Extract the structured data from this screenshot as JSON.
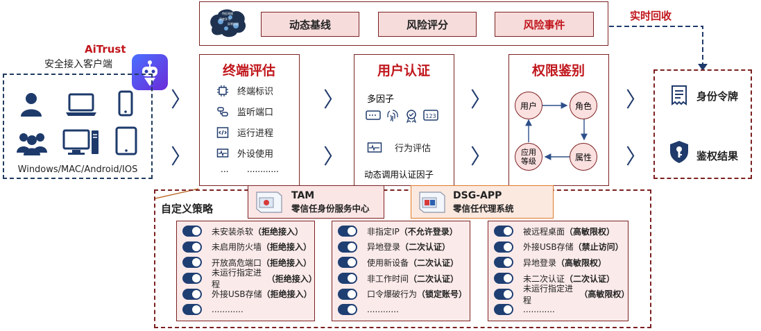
{
  "top": {
    "buttons": [
      "动态基线",
      "风险评分",
      "风险事件"
    ],
    "feedback_label": "实时回收"
  },
  "client": {
    "brand": "AiTrust",
    "subtitle": "安全接入客户端",
    "platforms": "Windows/MAC/Android/IOS"
  },
  "endpoint": {
    "title": "终端评估",
    "items": [
      "终端标识",
      "监听端口",
      "运行进程",
      "外设使用"
    ],
    "more_left": "...",
    "more_right": "............"
  },
  "auth": {
    "title": "用户认证",
    "multi_factor": "多因子",
    "behavior": "行为评估",
    "dynamic": "动态调用认证因子"
  },
  "perm": {
    "title": "权限鉴别",
    "nodes": {
      "user": "用户",
      "role": "角色",
      "app_level": "应用\n等级",
      "attr": "属性"
    }
  },
  "result": {
    "token": "身份令牌",
    "auth_result": "鉴权结果"
  },
  "systems": {
    "tam_name": "TAM",
    "tam_desc": "零信任身份服务中心",
    "dsg_name": "DSG-APP",
    "dsg_desc": "零信任代理系统"
  },
  "policy": {
    "title": "自定义策略",
    "col1": [
      [
        "未安装杀软",
        "（拒绝接入）"
      ],
      [
        "未启用防火墙",
        "（拒绝接入）"
      ],
      [
        "开放高危端口",
        "（拒绝接入）"
      ],
      [
        "未运行指定进程",
        "（拒绝接入）"
      ],
      [
        "外接USB存储",
        "（拒绝接入）"
      ],
      [
        "............",
        ""
      ]
    ],
    "col2": [
      [
        "非指定IP",
        "（不允许登录）"
      ],
      [
        "异地登录",
        "（二次认证）"
      ],
      [
        "使用新设备",
        "（二次认证）"
      ],
      [
        "非工作时间",
        "（二次认证）"
      ],
      [
        "口令爆破行为",
        "（锁定账号）"
      ],
      [
        "............",
        ""
      ]
    ],
    "col3": [
      [
        "被远程桌面",
        "（高敏限权）"
      ],
      [
        "外接USB存储",
        "（禁止访问）"
      ],
      [
        "异地登录",
        "（高敏限权）"
      ],
      [
        "未二次认证",
        "（二次认证）"
      ],
      [
        "未运行指定进程",
        "（高敏限权）"
      ],
      [
        "............",
        ""
      ]
    ]
  },
  "colors": {
    "accent": "#c0161c",
    "navy": "#1f3f73",
    "border": "#7b2020",
    "pink": "#fbeaea"
  }
}
